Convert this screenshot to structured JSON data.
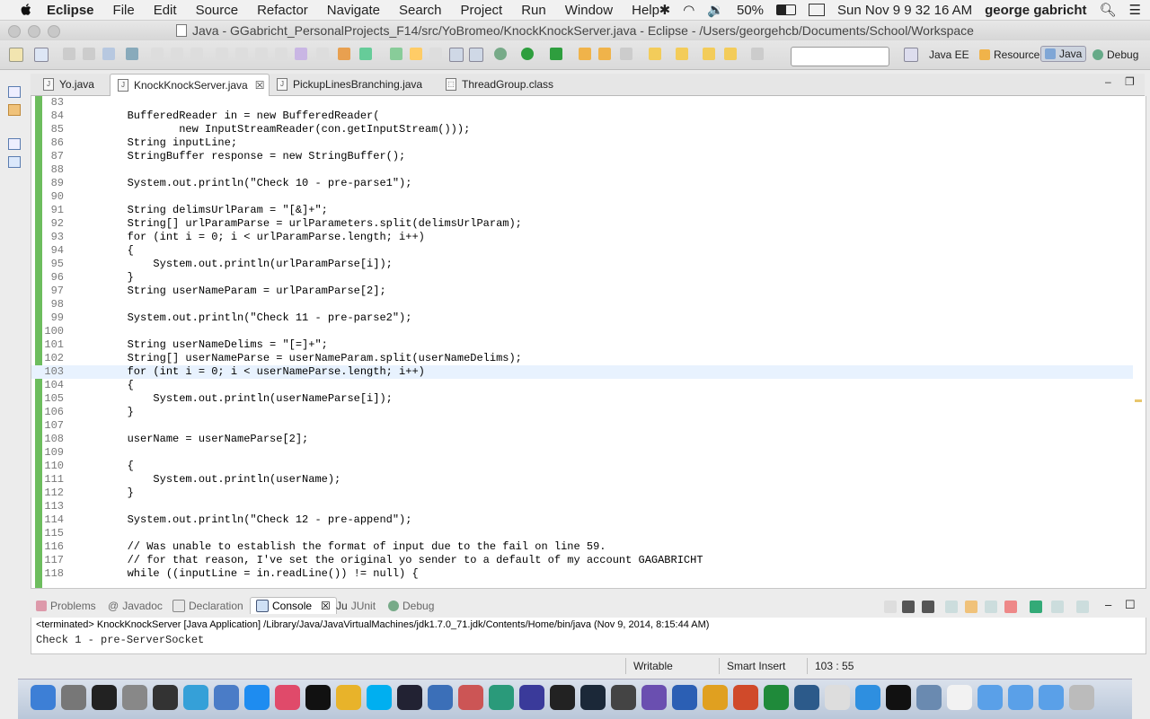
{
  "menubar": {
    "app_name": "Eclipse",
    "items": [
      "File",
      "Edit",
      "Source",
      "Refactor",
      "Navigate",
      "Search",
      "Project",
      "Run",
      "Window",
      "Help"
    ],
    "battery": "50%",
    "clock": "Sun Nov 9  9 32 16 AM",
    "user": "george gabricht"
  },
  "window": {
    "title": "Java - GGabricht_PersonalProjects_F14/src/YoBromeo/KnockKnockServer.java - Eclipse - /Users/georgehcb/Documents/School/Workspace"
  },
  "perspectives": [
    {
      "label": "Java EE",
      "selected": false
    },
    {
      "label": "Resource",
      "selected": false
    },
    {
      "label": "Java",
      "selected": true
    },
    {
      "label": "Debug",
      "selected": false
    }
  ],
  "editor_tabs": [
    {
      "label": "Yo.java",
      "active": false
    },
    {
      "label": "KnockKnockServer.java",
      "active": true
    },
    {
      "label": "PickupLinesBranching.java",
      "active": false
    },
    {
      "label": "ThreadGroup.class",
      "active": false
    }
  ],
  "code": {
    "current_line": 103,
    "lines": [
      {
        "n": "83",
        "t": ""
      },
      {
        "n": "84",
        "t": "        BufferedReader in = new BufferedReader("
      },
      {
        "n": "85",
        "t": "                new InputStreamReader(con.getInputStream()));"
      },
      {
        "n": "86",
        "t": "        String inputLine;"
      },
      {
        "n": "87",
        "t": "        StringBuffer response = new StringBuffer();"
      },
      {
        "n": "88",
        "t": ""
      },
      {
        "n": "89",
        "t": "        System.out.println(\"Check 10 - pre-parse1\");"
      },
      {
        "n": "90",
        "t": ""
      },
      {
        "n": "91",
        "t": "        String delimsUrlParam = \"[&]+\";"
      },
      {
        "n": "92",
        "t": "        String[] urlParamParse = urlParameters.split(delimsUrlParam);"
      },
      {
        "n": "93",
        "t": "        for (int i = 0; i < urlParamParse.length; i++)"
      },
      {
        "n": "94",
        "t": "        {"
      },
      {
        "n": "95",
        "t": "            System.out.println(urlParamParse[i]);"
      },
      {
        "n": "96",
        "t": "        }"
      },
      {
        "n": "97",
        "t": "        String userNameParam = urlParamParse[2];"
      },
      {
        "n": "98",
        "t": ""
      },
      {
        "n": "99",
        "t": "        System.out.println(\"Check 11 - pre-parse2\");"
      },
      {
        "n": "100",
        "t": ""
      },
      {
        "n": "101",
        "t": "        String userNameDelims = \"[=]+\";"
      },
      {
        "n": "102",
        "t": "        String[] userNameParse = userNameParam.split(userNameDelims);"
      },
      {
        "n": "103",
        "t": "        for (int i = 0; i < userNameParse.length; i++)"
      },
      {
        "n": "104",
        "t": "        {"
      },
      {
        "n": "105",
        "t": "            System.out.println(userNameParse[i]);"
      },
      {
        "n": "106",
        "t": "        }"
      },
      {
        "n": "107",
        "t": ""
      },
      {
        "n": "108",
        "t": "        userName = userNameParse[2];"
      },
      {
        "n": "109",
        "t": ""
      },
      {
        "n": "110",
        "t": "        {"
      },
      {
        "n": "111",
        "t": "            System.out.println(userName);"
      },
      {
        "n": "112",
        "t": "        }"
      },
      {
        "n": "113",
        "t": ""
      },
      {
        "n": "114",
        "t": "        System.out.println(\"Check 12 - pre-append\");"
      },
      {
        "n": "115",
        "t": ""
      },
      {
        "n": "116",
        "t": "        // Was unable to establish the format of input due to the fail on line 59."
      },
      {
        "n": "117",
        "t": "        // for that reason, I've set the original yo sender to a default of my account GAGABRICHT"
      },
      {
        "n": "118",
        "t": "        while ((inputLine = in.readLine()) != null) {"
      }
    ]
  },
  "bottom_tabs": [
    {
      "label": "Problems",
      "active": false
    },
    {
      "label": "Javadoc",
      "active": false
    },
    {
      "label": "Declaration",
      "active": false
    },
    {
      "label": "Console",
      "active": true
    },
    {
      "label": "JUnit",
      "active": false
    },
    {
      "label": "Debug",
      "active": false
    }
  ],
  "console": {
    "description": "<terminated> KnockKnockServer [Java Application] /Library/Java/JavaVirtualMachines/jdk1.7.0_71.jdk/Contents/Home/bin/java (Nov 9, 2014, 8:15:44 AM)",
    "output": "Check 1 - pre-ServerSocket"
  },
  "status": {
    "writable": "Writable",
    "insert_mode": "Smart Insert",
    "position": "103 : 55"
  },
  "dock": {
    "items": [
      "finder",
      "launchpad",
      "activity-monitor",
      "system-preferences",
      "dashboard",
      "xcode",
      "safari-compass",
      "app-store",
      "itunes",
      "terminal",
      "chrome",
      "skype",
      "misc",
      "quicktime",
      "sublime",
      "atom",
      "eclipse",
      "unreal",
      "steam",
      "misc2",
      "visual-studio",
      "word",
      "outlook",
      "powerpoint",
      "excel",
      "mysql",
      "text-edit",
      "safari",
      "terminal2",
      "preview",
      "textedit2",
      "folder-apps",
      "folder-docs",
      "folder-downloads",
      "trash"
    ]
  }
}
